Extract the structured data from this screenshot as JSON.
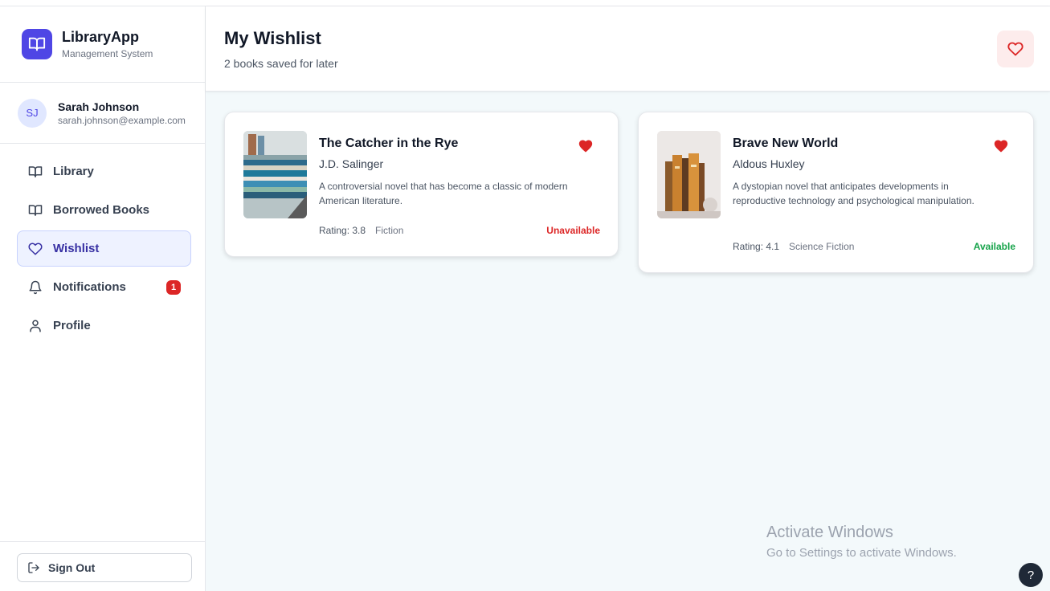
{
  "brand": {
    "name": "LibraryApp",
    "subtitle": "Management System"
  },
  "user": {
    "initials": "SJ",
    "name": "Sarah Johnson",
    "email": "sarah.johnson@example.com"
  },
  "nav": {
    "items": [
      {
        "label": "Library",
        "icon": "book-open-icon",
        "active": false
      },
      {
        "label": "Borrowed Books",
        "icon": "book-open-icon",
        "active": false
      },
      {
        "label": "Wishlist",
        "icon": "heart-icon",
        "active": true
      },
      {
        "label": "Notifications",
        "icon": "bell-icon",
        "active": false,
        "badge": "1"
      },
      {
        "label": "Profile",
        "icon": "user-icon",
        "active": false
      }
    ],
    "signout_label": "Sign Out"
  },
  "header": {
    "title": "My Wishlist",
    "subtitle": "2 books saved for later"
  },
  "books": [
    {
      "title": "The Catcher in the Rye",
      "author": "J.D. Salinger",
      "description": "A controversial novel that has become a classic of modern American literature.",
      "rating": "Rating: 3.8",
      "genre": "Fiction",
      "status": "Unavailable",
      "status_color": "#dc2626"
    },
    {
      "title": "Brave New World",
      "author": "Aldous Huxley",
      "description": "A dystopian novel that anticipates developments in reproductive technology and psychological manipulation.",
      "rating": "Rating: 4.1",
      "genre": "Science Fiction",
      "status": "Available",
      "status_color": "#16a34a"
    }
  ],
  "watermark": {
    "title": "Activate Windows",
    "subtitle": "Go to Settings to activate Windows."
  },
  "help": {
    "label": "?"
  },
  "colors": {
    "accent": "#4f46e5",
    "heart": "#dc2626",
    "active_bg": "#eef2ff"
  }
}
